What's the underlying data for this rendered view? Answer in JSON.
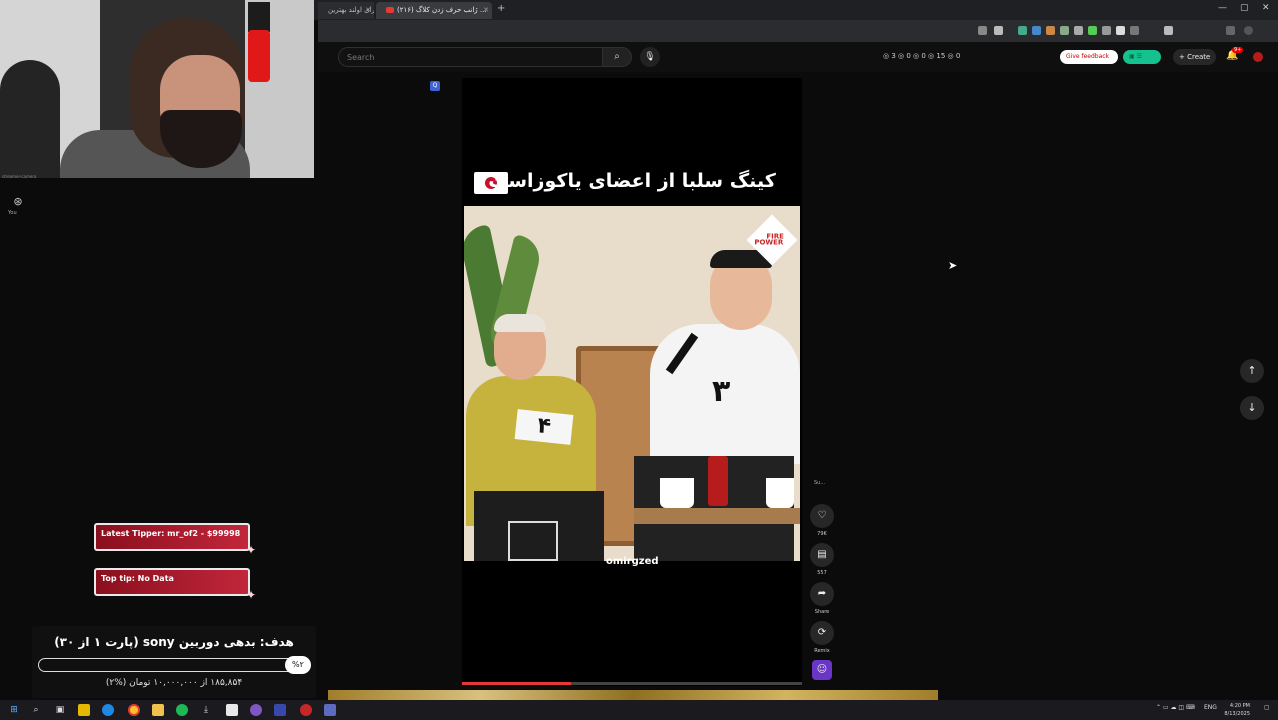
{
  "browser": {
    "tabs": [
      {
        "label": "برای اولند بهترین ...",
        "active": false
      },
      {
        "label": "(۲۱۶) ژانب حرف زدن کلاگ ...",
        "active": true
      }
    ],
    "new_tab": "+",
    "window_controls": [
      "—",
      "▢",
      "✕"
    ]
  },
  "youtube": {
    "search_placeholder": "Search",
    "stats": "◎ 3  ◎ 0  ◎ 0  ◎ 15  ◎ 0",
    "stream_button": "Give feedback",
    "create_label": "+ Create",
    "notification_count": "9+"
  },
  "webcam": {
    "side_label": "You",
    "cam_caption": "streamer-camera"
  },
  "video": {
    "title": "کینگ سلبا از اعضای یاکوزاست",
    "flag": "japan-flag",
    "badge_4": "۴",
    "badge_3": "۳",
    "brand": [
      "FIRE",
      "POWER"
    ],
    "watermark": "omirgzed",
    "progress": 0.32
  },
  "actions": {
    "subscribe_label": "Su...",
    "like_count": "79K",
    "comment_count": "557",
    "share_label": "Share",
    "remix_label": "Remix"
  },
  "overlays": {
    "latest_tipper": "Latest Tipper: mr_of2 - $99998",
    "top_tip": "Top tip: No Data",
    "goal_title": "هدف: بدهی دوربین sony (پارت ۱ از ۳۰)",
    "goal_percent": "%۲",
    "goal_sub": "۱۸۵,۸۵۴ از ۱۰,۰۰۰,۰۰۰ تومان (%۲)"
  },
  "taskbar": {
    "language": "ENG",
    "time": "4:20 PM",
    "date": "8/13/2025"
  },
  "colors": {
    "accent_red": "#e53935",
    "tip_gradient_start": "#8a0f1e",
    "tip_gradient_end": "#c2263b",
    "remix_purple": "#6a36c7"
  }
}
